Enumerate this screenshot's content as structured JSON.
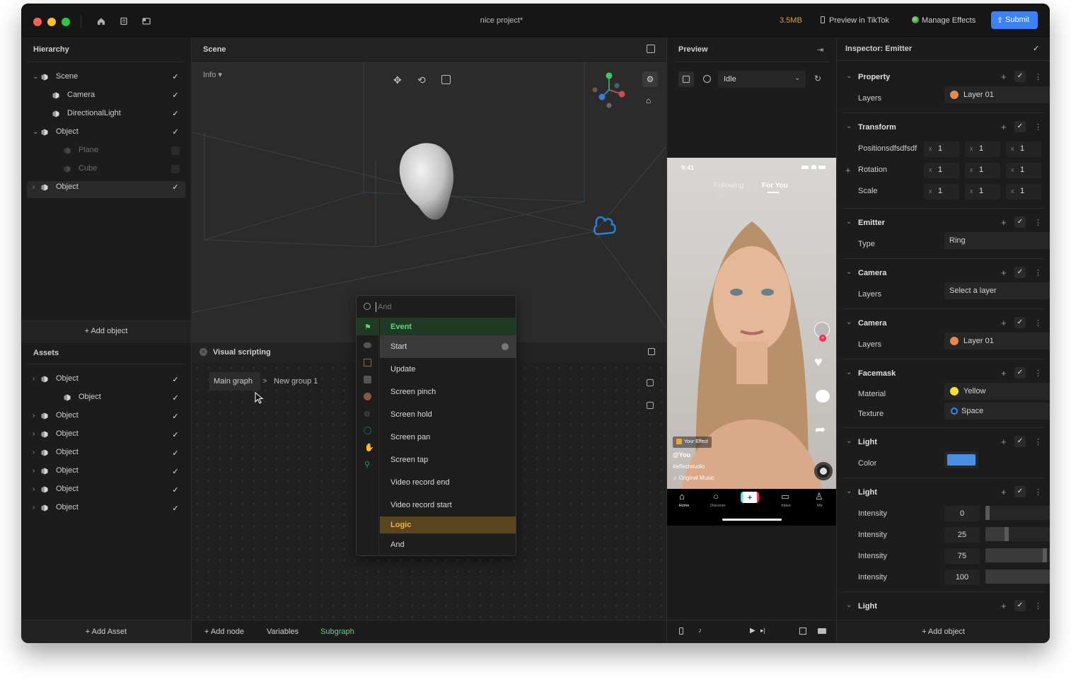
{
  "window": {
    "title": "nice project*",
    "size": "3.5MB",
    "preview_tiktok": "Preview in TikTok",
    "manage_effects": "Manage Effects",
    "submit": "Submit"
  },
  "hierarchy": {
    "title": "Hierarchy",
    "items": [
      {
        "label": "Scene"
      },
      {
        "label": "Camera"
      },
      {
        "label": "DirectionalLight"
      },
      {
        "label": "Object"
      },
      {
        "label": "Plane"
      },
      {
        "label": "Cube"
      },
      {
        "label": "Object"
      }
    ],
    "add_label": "+ Add object"
  },
  "assets": {
    "title": "Assets",
    "items": [
      {
        "label": "Object"
      },
      {
        "label": "Object"
      },
      {
        "label": "Object"
      },
      {
        "label": "Object"
      },
      {
        "label": "Object"
      },
      {
        "label": "Object"
      },
      {
        "label": "Object"
      },
      {
        "label": "Object"
      }
    ],
    "add_label": "+ Add Asset"
  },
  "scene": {
    "title": "Scene",
    "info_label": "Info"
  },
  "visual_scripting": {
    "title": "Visual scripting",
    "breadcrumb_main": "Main graph",
    "breadcrumb_sep": ">",
    "breadcrumb_group": "New group 1",
    "footer_add_node": "+ Add node",
    "footer_variables": "Variables",
    "footer_subgraph": "Subgraph"
  },
  "node_menu": {
    "search_placeholder": "And",
    "event_header": "Event",
    "events": [
      "Start",
      "Update",
      "Screen pinch",
      "Screen hold",
      "Screen pan",
      "Screen tap",
      "Video record end",
      "Video record start"
    ],
    "logic_header": "Logic",
    "logic_items": [
      "And"
    ]
  },
  "preview": {
    "title": "Preview",
    "state": "Idle",
    "phone": {
      "time": "9:41",
      "tab_following": "Following",
      "tab_for_you": "For You",
      "effect_badge": "Your Effect",
      "username": "@You",
      "hashtag": "#effectstudio",
      "music": "Original Music",
      "nav": [
        "Home",
        "Discover",
        "",
        "Inbox",
        "Me"
      ]
    }
  },
  "inspector": {
    "title": "Inspector: Emitter",
    "property": {
      "title": "Property",
      "layers_label": "Layers",
      "layers_value": "Layer 01"
    },
    "transform": {
      "title": "Transform",
      "rows": [
        {
          "label": "Positionsdfsdfsdf",
          "x": "1",
          "y": "1",
          "z": "1"
        },
        {
          "label": "Rotation",
          "x": "1",
          "y": "1",
          "z": "1"
        },
        {
          "label": "Scale",
          "x": "1",
          "y": "1",
          "z": "1"
        }
      ],
      "axis": "x"
    },
    "emitter": {
      "title": "Emitter",
      "type_label": "Type",
      "type_value": "Ring"
    },
    "camera1": {
      "title": "Camera",
      "layers_label": "Layers",
      "layers_value": "Select a layer"
    },
    "camera2": {
      "title": "Camera",
      "layers_label": "Layers",
      "layers_value": "Layer 01"
    },
    "facemask": {
      "title": "Facemask",
      "material_label": "Material",
      "material_value": "Yellow",
      "texture_label": "Texture",
      "texture_value": "Space"
    },
    "light1": {
      "title": "Light",
      "color_label": "Color",
      "color_value": "#4a90e2"
    },
    "light2": {
      "title": "Light",
      "intensities": [
        {
          "label": "Intensity",
          "value": "0",
          "fraction": 0.0
        },
        {
          "label": "Intensity",
          "value": "25",
          "fraction": 0.25
        },
        {
          "label": "Intensity",
          "value": "75",
          "fraction": 0.75
        },
        {
          "label": "Intensity",
          "value": "100",
          "fraction": 1.0
        }
      ]
    },
    "light3": {
      "title": "Light"
    },
    "add_label": "+ Add object"
  },
  "colors": {
    "accent_blue": "#3b82f6",
    "event_green": "#1a3a1e",
    "logic_brown": "#5a4520",
    "subgraph_green": "#5fd77a"
  }
}
